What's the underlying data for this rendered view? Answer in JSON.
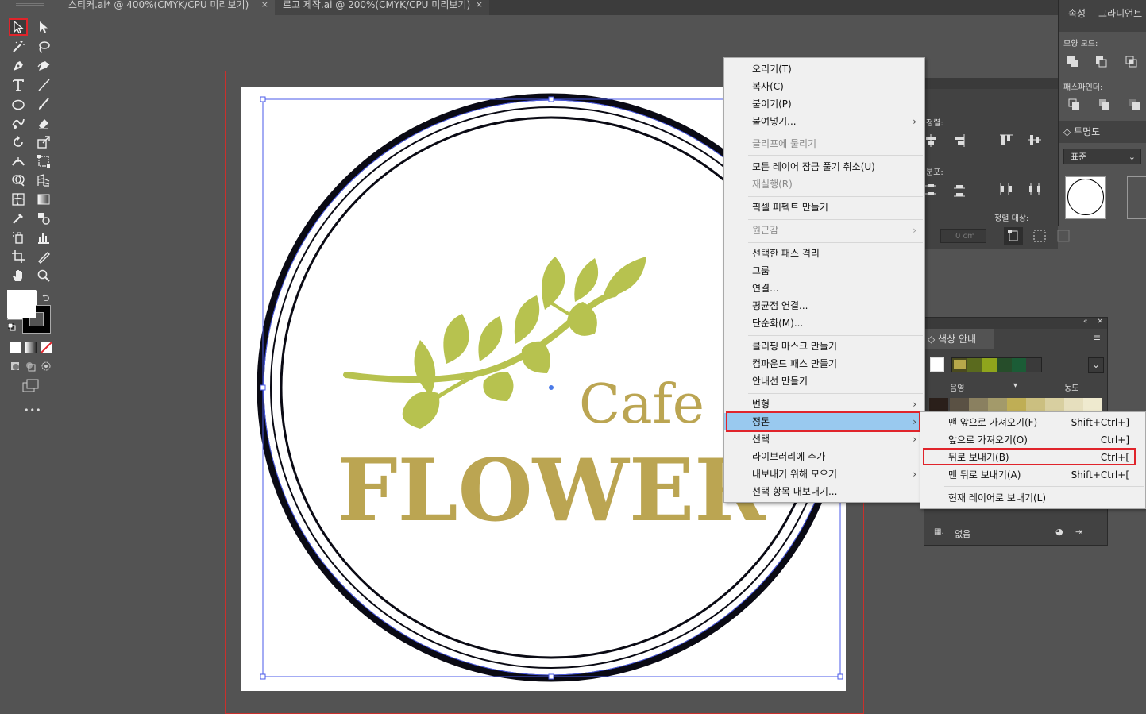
{
  "tabs": [
    {
      "label": "스티커.ai* @ 400%(CMYK/CPU 미리보기)",
      "close": "×"
    },
    {
      "label": "로고 제작.ai @ 200%(CMYK/CPU 미리보기)",
      "close": "×"
    }
  ],
  "toolbar": {
    "more_label": "•••"
  },
  "artwork": {
    "cafe_text": "Cafe",
    "flower_text": "FLOWER",
    "leaf_color": "#b7c24f",
    "text_color": "#bba552"
  },
  "properties_panel": {
    "tab_properties": "속성",
    "tab_gradient": "그라디언트",
    "shape_modes": "모양 모드:",
    "pathfinder": "패스파인더:",
    "transparency": "투명도",
    "blend_mode": "표준"
  },
  "align_panel": {
    "align_label": "정렬:",
    "distribute_label": "분포:",
    "align_to": "정렬 대상:",
    "spacing_value": "0 cm"
  },
  "color_guide": {
    "title": "색상 안내",
    "shade_label": "음영",
    "tint_label": "농도",
    "footer_none": "없음",
    "swatches": [
      "#4a4a1e",
      "#b7a84a",
      "#5a6a1e",
      "#8fa51c",
      "#264d2a",
      "#1b5c36"
    ],
    "shades": [
      "#2a1f1a",
      "#5a5144",
      "#8a8060",
      "#a39a6a",
      "#bfae55",
      "#cbbf80",
      "#d8cfa0",
      "#e6dfbe",
      "#efeacf"
    ]
  },
  "context_menu": {
    "items": [
      {
        "label": "오리기(T)",
        "disabled": false
      },
      {
        "label": "복사(C)",
        "disabled": false
      },
      {
        "label": "붙이기(P)",
        "disabled": false
      },
      {
        "label": "붙여넣기...",
        "disabled": false,
        "submenu": true
      },
      {
        "label": "글리프에 물리기",
        "disabled": true
      },
      {
        "label": "모든 레이어 잠금 풀기 취소(U)",
        "disabled": false
      },
      {
        "label": "재실행(R)",
        "disabled": true
      },
      {
        "label": "픽셀 퍼펙트 만들기",
        "disabled": false
      },
      {
        "label": "원근감",
        "disabled": true,
        "submenu": true
      },
      {
        "label": "선택한 패스 격리",
        "disabled": false
      },
      {
        "label": "그룹",
        "disabled": false
      },
      {
        "label": "연결...",
        "disabled": false
      },
      {
        "label": "평균점 연결...",
        "disabled": false
      },
      {
        "label": "단순화(M)...",
        "disabled": false
      },
      {
        "label": "클리핑 마스크 만들기",
        "disabled": false
      },
      {
        "label": "컴파운드 패스 만들기",
        "disabled": false
      },
      {
        "label": "안내선 만들기",
        "disabled": false
      },
      {
        "label": "변형",
        "disabled": false,
        "submenu": true
      },
      {
        "label": "정돈",
        "disabled": false,
        "submenu": true,
        "highlighted": true
      },
      {
        "label": "선택",
        "disabled": false,
        "submenu": true
      },
      {
        "label": "라이브러리에 추가",
        "disabled": false
      },
      {
        "label": "내보내기 위해 모으기",
        "disabled": false,
        "submenu": true
      },
      {
        "label": "선택 항목 내보내기...",
        "disabled": false
      }
    ],
    "arrow": "›"
  },
  "arrange_submenu": {
    "items": [
      {
        "label": "맨 앞으로 가져오기(F)",
        "shortcut": "Shift+Ctrl+]"
      },
      {
        "label": "앞으로 가져오기(O)",
        "shortcut": "Ctrl+]"
      },
      {
        "label": "뒤로 보내기(B)",
        "shortcut": "Ctrl+["
      },
      {
        "label": "맨 뒤로 보내기(A)",
        "shortcut": "Shift+Ctrl+["
      },
      {
        "label": "현재 레이어로 보내기(L)",
        "shortcut": ""
      }
    ]
  }
}
